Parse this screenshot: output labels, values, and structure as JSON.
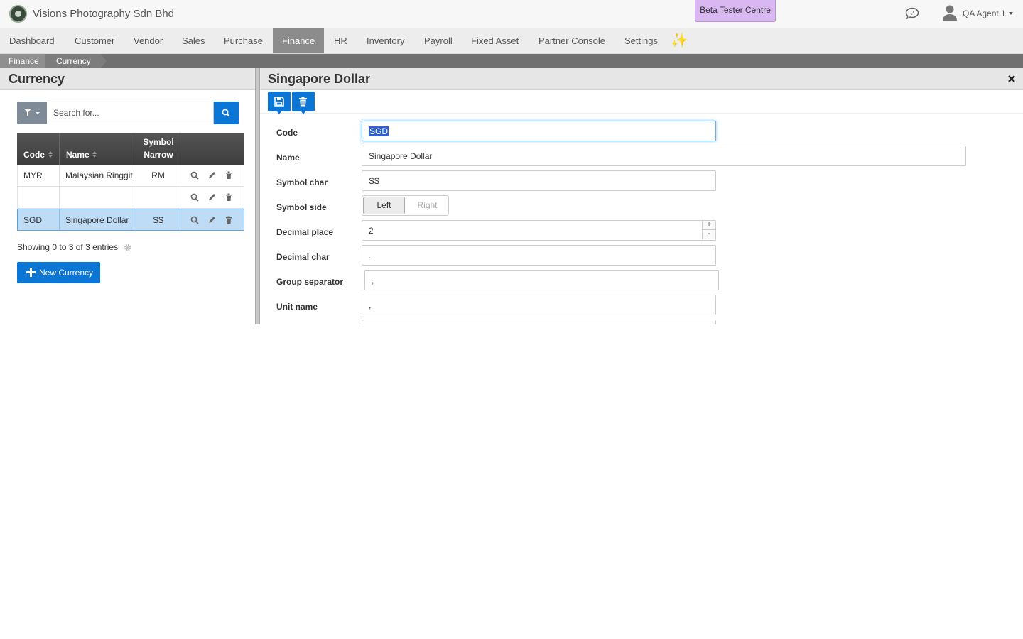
{
  "header": {
    "company": "Visions Photography Sdn Bhd",
    "beta_label": "Beta Tester Centre",
    "user_name": "QA Agent 1"
  },
  "nav": {
    "items": [
      "Dashboard",
      "Customer",
      "Vendor",
      "Sales",
      "Purchase",
      "Finance",
      "HR",
      "Inventory",
      "Payroll",
      "Fixed Asset",
      "Partner Console",
      "Settings"
    ],
    "active": "Finance",
    "sparkle": "✨"
  },
  "breadcrumb": [
    "Finance",
    "Currency"
  ],
  "list_panel": {
    "title": "Currency",
    "search_placeholder": "Search for...",
    "columns": {
      "code": "Code",
      "name": "Name",
      "symbol_line1": "Symbol",
      "symbol_line2": "Narrow"
    },
    "rows": [
      {
        "code": "MYR",
        "name": "Malaysian Ringgit",
        "symbol": "RM",
        "selected": false
      },
      {
        "code": "",
        "name": "",
        "symbol": "",
        "selected": false
      },
      {
        "code": "SGD",
        "name": "Singapore Dollar",
        "symbol": "S$",
        "selected": true
      }
    ],
    "showing": "Showing 0 to 3 of 3 entries",
    "new_button": "New Currency"
  },
  "detail_panel": {
    "title": "Singapore Dollar",
    "close_glyph": "×",
    "fields": {
      "code": {
        "label": "Code",
        "value": "SGD"
      },
      "name": {
        "label": "Name",
        "value": "Singapore Dollar"
      },
      "symbol_char": {
        "label": "Symbol char",
        "value": "S$"
      },
      "symbol_side": {
        "label": "Symbol side",
        "options": [
          "Left",
          "Right"
        ],
        "selected": "Left"
      },
      "decimal_place": {
        "label": "Decimal place",
        "value": "2",
        "up": "+",
        "down": "-"
      },
      "decimal_char": {
        "label": "Decimal char",
        "value": "."
      },
      "group_separator": {
        "label": "Group separator",
        "value": ","
      },
      "unit_name": {
        "label": "Unit name",
        "value": ","
      }
    }
  },
  "colors": {
    "primary": "#0b76d6",
    "nav_active": "#8c8c8c",
    "beta_bg": "#d9b8f2",
    "selected_row": "#bfdcf7"
  }
}
